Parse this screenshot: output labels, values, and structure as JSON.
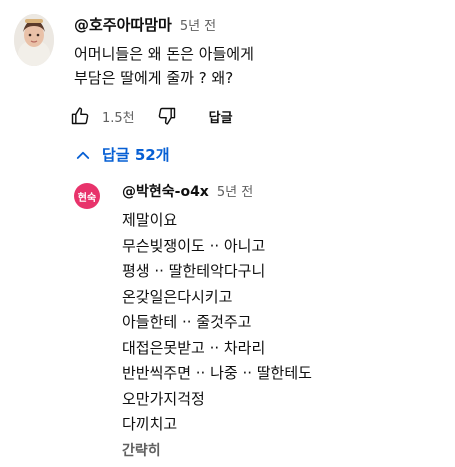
{
  "comment": {
    "author": "@호주아따맘마",
    "time": "5년 전",
    "lines": [
      "어머니들은 왜 돈은 아들에게",
      "부담은 딸에게 줄까 ? 왜?"
    ],
    "like_count": "1.5천",
    "reply_label": "답글",
    "icons": {
      "like": "thumbs-up-icon",
      "dislike": "thumbs-down-icon"
    }
  },
  "replies": {
    "toggle_label": "답글 52개",
    "toggle_icon": "chevron-up-icon",
    "accent": "#065fd4",
    "items": [
      {
        "avatar_text": "현숙",
        "avatar_color": "#e8336b",
        "author": "@박현숙-o4x",
        "time": "5년 전",
        "lines": [
          "제말이요",
          "무슨빚쟁이도 ·· 아니고",
          "평생 ·· 딸한테악다구니",
          "온갖일은다시키고",
          "아들한테 ·· 줄것주고",
          "대접은못받고 ·· 차라리",
          "반반씩주면 ·· 나중 ·· 딸한테도",
          "오만가지걱정",
          "다끼치고"
        ],
        "collapse_label": "간략히"
      }
    ]
  }
}
